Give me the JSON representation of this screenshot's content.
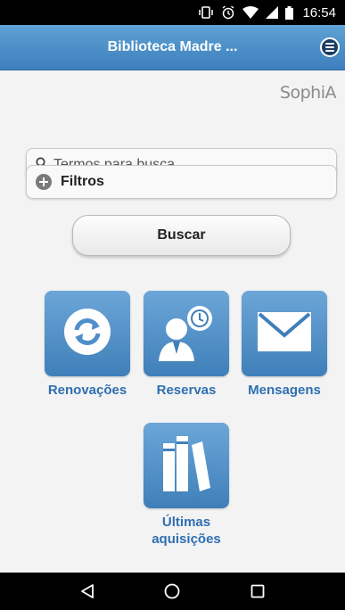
{
  "status_bar": {
    "time": "16:54",
    "icons": [
      "vibrate-icon",
      "alarm-icon",
      "wifi-icon",
      "signal-icon",
      "battery-icon"
    ]
  },
  "app_bar": {
    "title": "Biblioteca Madre ...",
    "menu_icon": "menu-icon"
  },
  "brand": {
    "logo_text": "SophiA"
  },
  "search": {
    "placeholder": "Termos para busca",
    "value": ""
  },
  "filters": {
    "label": "Filtros"
  },
  "buscar_button": {
    "label": "Buscar"
  },
  "tiles": [
    {
      "label": "Renovações",
      "icon": "refresh-icon"
    },
    {
      "label": "Reservas",
      "icon": "person-clock-icon"
    },
    {
      "label": "Mensagens",
      "icon": "envelope-icon"
    },
    {
      "label_line1": "Últimas",
      "label_line2": "aquisições",
      "icon": "books-icon"
    }
  ],
  "nav_bar": {
    "buttons": [
      "back-icon",
      "home-icon",
      "recents-icon"
    ]
  },
  "colors": {
    "app_bar": "#4b8ec9",
    "tile": "#4f8fc9",
    "tile_label": "#2f6fb1",
    "background": "#f3f3f3"
  }
}
